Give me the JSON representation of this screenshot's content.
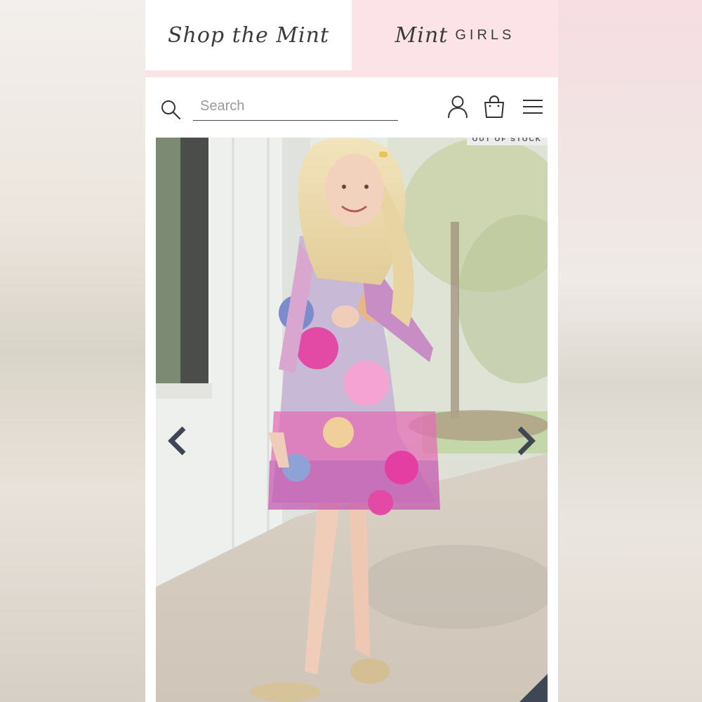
{
  "tabs": {
    "shop_label": "Shop the Mint",
    "girls_script": "Mint",
    "girls_word": "GIRLS"
  },
  "header": {
    "search_placeholder": "Search"
  },
  "product": {
    "badge": "OUT OF STOCK"
  },
  "icons": {
    "search": "search-icon",
    "account": "user-icon",
    "bag": "shopping-bag-icon",
    "menu": "hamburger-menu-icon",
    "prev": "chevron-left-icon",
    "next": "chevron-right-icon"
  },
  "colors": {
    "tab_active_bg": "#ffffff",
    "tab_inactive_bg": "#fbe3e7",
    "text": "#3b3b3b",
    "arrow": "#3f4654"
  }
}
